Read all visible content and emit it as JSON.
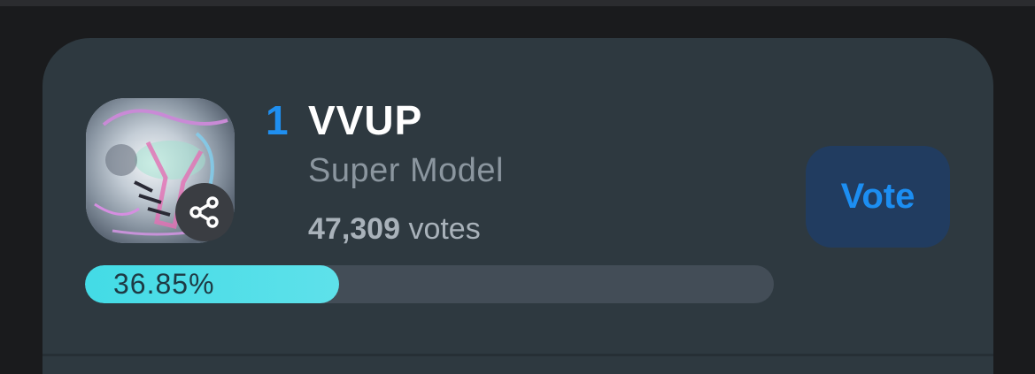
{
  "entry": {
    "rank": "1",
    "artist": "VVUP",
    "song": "Super Model",
    "vote_count": "47,309",
    "vote_unit": "votes",
    "percent_label": "36.85%",
    "percent_value": 36.85
  },
  "actions": {
    "vote_label": "Vote",
    "share_icon": "share-icon"
  },
  "colors": {
    "accent": "#1f8ff0",
    "card_bg": "#2e3940",
    "vote_button_bg": "#213c60",
    "progress_fill": "#43dbe6",
    "progress_track": "#434d57"
  }
}
